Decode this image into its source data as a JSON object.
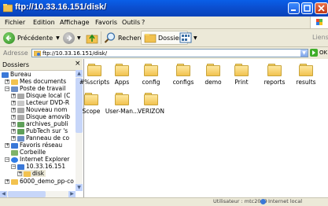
{
  "window": {
    "title": "ftp://10.33.16.151/disk/"
  },
  "menu": {
    "items": [
      "Fichier",
      "Edition",
      "Affichage",
      "Favoris",
      "Outils",
      "?"
    ]
  },
  "toolbar": {
    "back_label": "Précédente",
    "search_label": "Rechercher",
    "folders_label": "Dossiers",
    "links_label": "Liens"
  },
  "address": {
    "label": "Adresse",
    "value": "ftp://10.33.16.151/disk/",
    "go_label": "OK"
  },
  "sidebar": {
    "title": "Dossiers",
    "tree": [
      {
        "label": "Bureau"
      },
      {
        "label": "Mes documents"
      },
      {
        "label": "Poste de travail"
      },
      {
        "label": "Disque local (C"
      },
      {
        "label": "Lecteur DVD-R"
      },
      {
        "label": "Nouveau nom"
      },
      {
        "label": "Disque amovib"
      },
      {
        "label": "archives_publi"
      },
      {
        "label": "PubTech sur 's"
      },
      {
        "label": "Panneau de co"
      },
      {
        "label": "Favoris réseau"
      },
      {
        "label": "Corbeille"
      },
      {
        "label": "Internet Explorer"
      },
      {
        "label": "10.33.16.151"
      },
      {
        "label": "disk"
      },
      {
        "label": "6000_demo_pp-co"
      }
    ]
  },
  "files": [
    {
      "label": "#%scripts"
    },
    {
      "label": "Apps"
    },
    {
      "label": "config"
    },
    {
      "label": "configs"
    },
    {
      "label": "demo"
    },
    {
      "label": "Print"
    },
    {
      "label": "reports"
    },
    {
      "label": "results"
    },
    {
      "label": "Scope"
    },
    {
      "label": "User-Man..."
    },
    {
      "label": "VERIZON"
    }
  ],
  "status": {
    "user": "Utilisateur : mtc2009",
    "zone": "Internet local"
  }
}
